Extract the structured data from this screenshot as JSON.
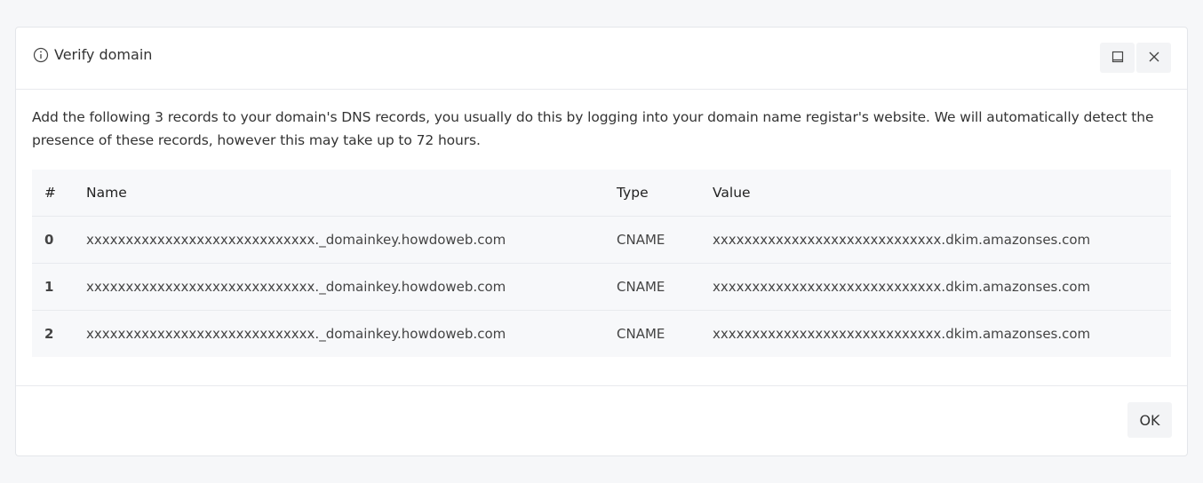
{
  "dialog": {
    "title": "Verify domain",
    "icons": {
      "title": "info-icon",
      "maximize": "maximize-icon",
      "close": "close-icon"
    },
    "description": "Add the following 3 records to your domain's DNS records, you usually do this by logging into your domain name registar's website. We will automatically detect the presence of these records, however this may take up to 72 hours.",
    "table": {
      "headers": {
        "num": "#",
        "name": "Name",
        "type": "Type",
        "value": "Value"
      },
      "rows": [
        {
          "num": "0",
          "name": "xxxxxxxxxxxxxxxxxxxxxxxxxxxxx._domainkey.howdoweb.com",
          "type": "CNAME",
          "value": "xxxxxxxxxxxxxxxxxxxxxxxxxxxxx.dkim.amazonses.com"
        },
        {
          "num": "1",
          "name": "xxxxxxxxxxxxxxxxxxxxxxxxxxxxx._domainkey.howdoweb.com",
          "type": "CNAME",
          "value": "xxxxxxxxxxxxxxxxxxxxxxxxxxxxx.dkim.amazonses.com"
        },
        {
          "num": "2",
          "name": "xxxxxxxxxxxxxxxxxxxxxxxxxxxxx._domainkey.howdoweb.com",
          "type": "CNAME",
          "value": "xxxxxxxxxxxxxxxxxxxxxxxxxxxxx.dkim.amazonses.com"
        }
      ]
    },
    "ok_label": "OK"
  }
}
